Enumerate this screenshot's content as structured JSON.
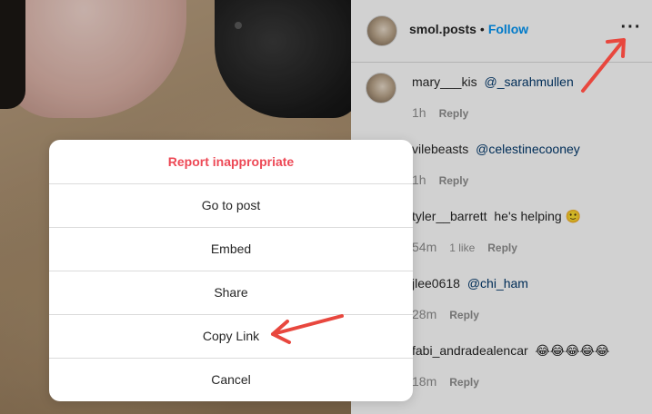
{
  "post": {
    "username": "smol.posts",
    "separator": "•",
    "follow_label": "Follow",
    "more_icon": "more-options-icon"
  },
  "comments": [
    {
      "user": "mary___kis",
      "text": "@_sarahmullen",
      "time": "1h",
      "likes": "",
      "reply": "Reply",
      "avatar_visible": true
    },
    {
      "user": "vilebeasts",
      "text": "@celestinecooney",
      "time": "1h",
      "likes": "",
      "reply": "Reply",
      "avatar_visible": false
    },
    {
      "user": "tyler__barrett",
      "text": "he's helping 🙂",
      "time": "54m",
      "likes": "1 like",
      "reply": "Reply",
      "avatar_visible": false
    },
    {
      "user": "jlee0618",
      "text": "@chi_ham",
      "time": "28m",
      "likes": "",
      "reply": "Reply",
      "avatar_visible": false
    },
    {
      "user": "fabi_andradealencar",
      "text": "😂😂😂😂😂",
      "time": "18m",
      "likes": "",
      "reply": "Reply",
      "avatar_visible": false
    }
  ],
  "modal": {
    "items": [
      {
        "label": "Report inappropriate",
        "style": "danger"
      },
      {
        "label": "Go to post",
        "style": "normal"
      },
      {
        "label": "Embed",
        "style": "normal"
      },
      {
        "label": "Share",
        "style": "normal"
      },
      {
        "label": "Copy Link",
        "style": "normal"
      },
      {
        "label": "Cancel",
        "style": "normal"
      }
    ]
  },
  "colors": {
    "danger": "#ed4956",
    "link": "#0095f6",
    "mention": "#00376b",
    "annotation_arrow": "#e8473e"
  }
}
